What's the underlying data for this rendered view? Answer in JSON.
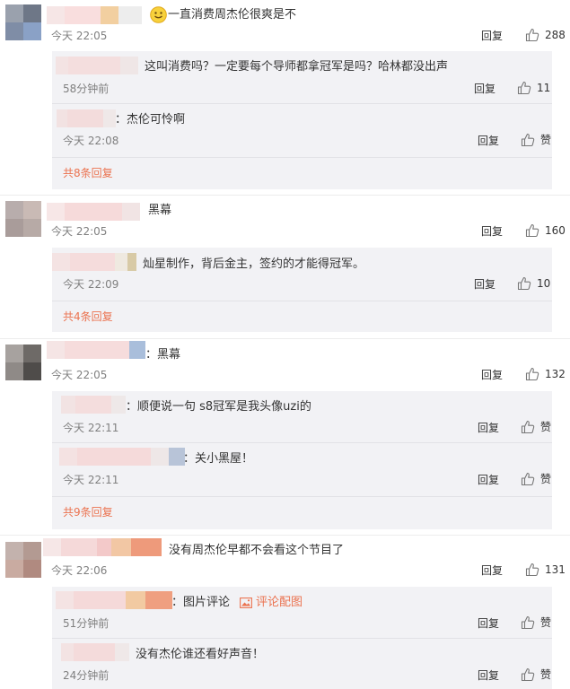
{
  "comments": [
    {
      "text": "一直消费周杰伦很爽是不",
      "time": "今天 22:05",
      "reply_label": "回复",
      "likes": "288",
      "replies": [
        {
          "text": "这叫消费吗？一定要每个导师都拿冠军是吗？哈林都没出声",
          "time": "58分钟前",
          "reply_label": "回复",
          "likes": "11"
        },
        {
          "text": "：杰伦可怜啊",
          "time": "今天 22:08",
          "reply_label": "回复",
          "likes": "赞"
        }
      ],
      "more": "共8条回复"
    },
    {
      "text": "黑幕",
      "time": "今天 22:05",
      "reply_label": "回复",
      "likes": "160",
      "replies": [
        {
          "text": "灿星制作，背后金主，签约的才能得冠军。",
          "time": "今天 22:09",
          "reply_label": "回复",
          "likes": "10"
        }
      ],
      "more": "共4条回复"
    },
    {
      "text": "：黑幕",
      "time": "今天 22:05",
      "reply_label": "回复",
      "likes": "132",
      "replies": [
        {
          "text": "：顺便说一句 s8冠军是我头像uzi的",
          "time": "今天 22:11",
          "reply_label": "回复",
          "likes": "赞"
        },
        {
          "text": "：关小黑屋！",
          "time": "今天 22:11",
          "reply_label": "回复",
          "likes": "赞"
        }
      ],
      "more": "共9条回复"
    },
    {
      "text": "没有周杰伦早都不会看这个节目了",
      "time": "今天 22:06",
      "reply_label": "回复",
      "likes": "131",
      "replies": [
        {
          "text": "：图片评论",
          "link": "评论配图",
          "time": "51分钟前",
          "reply_label": "回复",
          "likes": "赞"
        },
        {
          "text": "没有杰伦谁还看好声音！",
          "time": "24分钟前",
          "reply_label": "回复",
          "likes": "赞"
        }
      ]
    }
  ],
  "icons": {
    "like": "thumbs-up-icon",
    "emoji": "smile-emoji-icon",
    "picture": "picture-icon"
  },
  "colors": {
    "link": "#eb7350",
    "muted": "#808080",
    "reply_bg": "#f2f2f5"
  }
}
